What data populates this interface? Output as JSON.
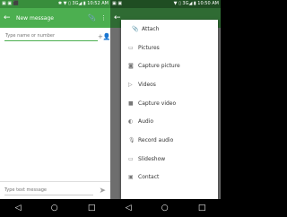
{
  "left": {
    "status": {
      "left": "▣ ▣ ⬛",
      "right": "✱ ▼ ▯ 3G◢ ▮ 10:52 AM"
    },
    "toolbar": {
      "back": "←",
      "title": "New message",
      "attach_icon": "📎",
      "menu_icon": "⋮"
    },
    "to_field": {
      "placeholder": "Type name or number",
      "contact_icon": "+👤"
    },
    "compose": {
      "placeholder": "Type text message",
      "send_icon": "➤"
    },
    "nav": {
      "back": "◁",
      "home": "○",
      "recent": "□"
    }
  },
  "right": {
    "status": {
      "left": "▣ ▣",
      "right": "▼ ▯ 3G◢ ▮ 10:50 AM"
    },
    "toolbar": {
      "back": "←"
    },
    "menu": {
      "items": [
        {
          "label": "Attach",
          "icon": "📎"
        },
        {
          "label": "Pictures",
          "icon": "▭"
        },
        {
          "label": "Capture picture",
          "icon": "◙"
        },
        {
          "label": "Videos",
          "icon": "▷"
        },
        {
          "label": "Capture video",
          "icon": "■"
        },
        {
          "label": "Audio",
          "icon": "◐"
        },
        {
          "label": "Record audio",
          "icon": "🎙"
        },
        {
          "label": "Slideshow",
          "icon": "▭"
        },
        {
          "label": "Contact",
          "icon": "▣"
        }
      ]
    },
    "nav": {
      "back": "◁",
      "home": "○",
      "recent": "□"
    }
  }
}
